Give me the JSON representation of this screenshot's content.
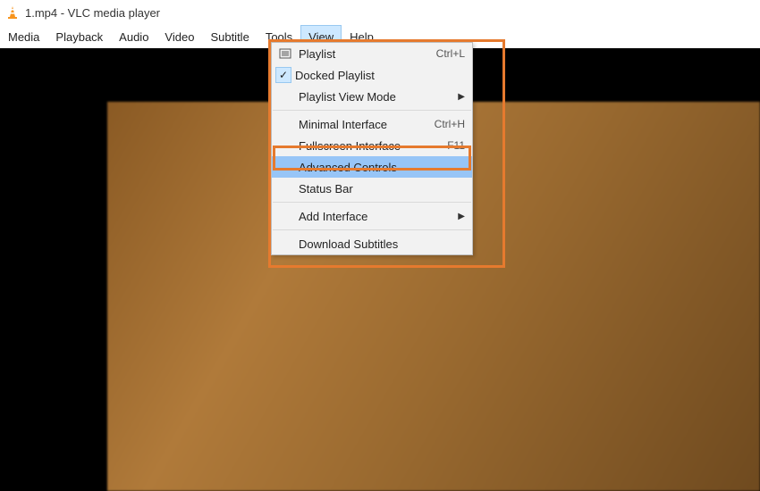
{
  "window": {
    "title": "1.mp4 - VLC media player"
  },
  "menubar": {
    "items": [
      {
        "label": "Media"
      },
      {
        "label": "Playback"
      },
      {
        "label": "Audio"
      },
      {
        "label": "Video"
      },
      {
        "label": "Subtitle"
      },
      {
        "label": "Tools"
      },
      {
        "label": "View",
        "open": true
      },
      {
        "label": "Help"
      }
    ]
  },
  "view_menu": {
    "items": [
      {
        "label": "Playlist",
        "accel": "Ctrl+L",
        "icon": "playlist"
      },
      {
        "label": "Docked Playlist",
        "icon": "check"
      },
      {
        "label": "Playlist View Mode",
        "submenu": true
      },
      {
        "sep": true
      },
      {
        "label": "Minimal Interface",
        "accel": "Ctrl+H"
      },
      {
        "label": "Fullscreen Interface",
        "accel": "F11"
      },
      {
        "label": "Advanced Controls",
        "highlight": true
      },
      {
        "label": "Status Bar"
      },
      {
        "sep": true
      },
      {
        "label": "Add Interface",
        "submenu": true
      },
      {
        "sep": true
      },
      {
        "label": "Download Subtitles"
      }
    ]
  }
}
